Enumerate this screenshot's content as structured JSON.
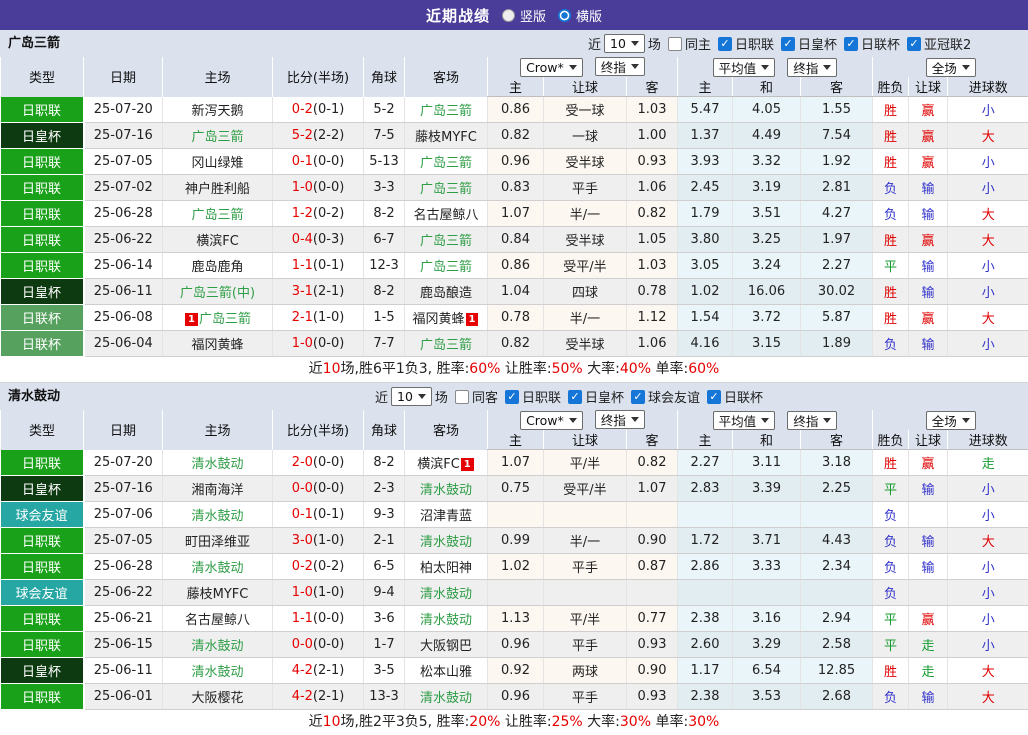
{
  "topbar": {
    "title": "近期战绩",
    "radios": [
      {
        "label": "竖版",
        "checked": false
      },
      {
        "label": "横版",
        "checked": true
      }
    ],
    "bar_color": "#4A3C99"
  },
  "colors": {
    "type_league": {
      "日职联": "#1AA11A",
      "日皇杯": "#0D3A10",
      "日联杯": "#57A15F",
      "球会友谊": "#27A7A4"
    },
    "result": {
      "red": "#E00000",
      "blue": "#3333CC",
      "green": "#149B2E"
    },
    "team_highlight": "#2E9E46",
    "score": "#E60000",
    "checkbox": "#1576D8"
  },
  "table_header": {
    "left_cols": [
      "类型",
      "日期",
      "主场",
      "比分(半场)",
      "角球",
      "客场"
    ],
    "group1_dropdowns": [
      "Crow*",
      "终指"
    ],
    "group2_dropdowns": [
      "平均值",
      "终指"
    ],
    "group3_dropdown": "全场",
    "sub_cols": [
      "主",
      "让球",
      "客",
      "主",
      "和",
      "客",
      "胜负",
      "让球",
      "进球数"
    ]
  },
  "sections": [
    {
      "team": "广岛三箭",
      "filter": {
        "prefix": "近",
        "count": "10",
        "suffix": "场",
        "same": {
          "label": "同主",
          "checked": false
        },
        "leagues": [
          {
            "label": "日职联",
            "checked": true
          },
          {
            "label": "日皇杯",
            "checked": true
          },
          {
            "label": "日联杯",
            "checked": true
          },
          {
            "label": "亚冠联2",
            "checked": true
          }
        ]
      },
      "rows": [
        {
          "type": "日职联",
          "date": "25-07-20",
          "home": "新泻天鹅",
          "home_hl": false,
          "home_badge": "",
          "score_ft": "0-2",
          "score_ht": "(0-1)",
          "corner": "5-2",
          "away": "广岛三箭",
          "away_hl": true,
          "away_badge": "",
          "odds_home": "0.86",
          "odds_hcap": "受一球",
          "odds_away": "1.03",
          "avg_home": "5.47",
          "avg_draw": "4.05",
          "avg_away": "1.55",
          "res_wdl": "胜",
          "res_wdl_color": "red",
          "res_hcap": "赢",
          "res_hcap_color": "red",
          "res_goals": "小",
          "res_goals_color": "blue"
        },
        {
          "type": "日皇杯",
          "date": "25-07-16",
          "home": "广岛三箭",
          "home_hl": true,
          "home_badge": "",
          "score_ft": "5-2",
          "score_ht": "(2-2)",
          "corner": "7-5",
          "away": "藤枝MYFC",
          "away_hl": false,
          "away_badge": "",
          "odds_home": "0.82",
          "odds_hcap": "一球",
          "odds_away": "1.00",
          "avg_home": "1.37",
          "avg_draw": "4.49",
          "avg_away": "7.54",
          "res_wdl": "胜",
          "res_wdl_color": "red",
          "res_hcap": "赢",
          "res_hcap_color": "red",
          "res_goals": "大",
          "res_goals_color": "red"
        },
        {
          "type": "日职联",
          "date": "25-07-05",
          "home": "冈山绿雉",
          "home_hl": false,
          "home_badge": "",
          "score_ft": "0-1",
          "score_ht": "(0-0)",
          "corner": "5-13",
          "away": "广岛三箭",
          "away_hl": true,
          "away_badge": "",
          "odds_home": "0.96",
          "odds_hcap": "受半球",
          "odds_away": "0.93",
          "avg_home": "3.93",
          "avg_draw": "3.32",
          "avg_away": "1.92",
          "res_wdl": "胜",
          "res_wdl_color": "red",
          "res_hcap": "赢",
          "res_hcap_color": "red",
          "res_goals": "小",
          "res_goals_color": "blue"
        },
        {
          "type": "日职联",
          "date": "25-07-02",
          "home": "神户胜利船",
          "home_hl": false,
          "home_badge": "",
          "score_ft": "1-0",
          "score_ht": "(0-0)",
          "corner": "3-3",
          "away": "广岛三箭",
          "away_hl": true,
          "away_badge": "",
          "odds_home": "0.83",
          "odds_hcap": "平手",
          "odds_away": "1.06",
          "avg_home": "2.45",
          "avg_draw": "3.19",
          "avg_away": "2.81",
          "res_wdl": "负",
          "res_wdl_color": "blue",
          "res_hcap": "输",
          "res_hcap_color": "blue",
          "res_goals": "小",
          "res_goals_color": "blue"
        },
        {
          "type": "日职联",
          "date": "25-06-28",
          "home": "广岛三箭",
          "home_hl": true,
          "home_badge": "",
          "score_ft": "1-2",
          "score_ht": "(0-2)",
          "corner": "8-2",
          "away": "名古屋鲸八",
          "away_hl": false,
          "away_badge": "",
          "odds_home": "1.07",
          "odds_hcap": "半/一",
          "odds_away": "0.82",
          "avg_home": "1.79",
          "avg_draw": "3.51",
          "avg_away": "4.27",
          "res_wdl": "负",
          "res_wdl_color": "blue",
          "res_hcap": "输",
          "res_hcap_color": "blue",
          "res_goals": "大",
          "res_goals_color": "red"
        },
        {
          "type": "日职联",
          "date": "25-06-22",
          "home": "横滨FC",
          "home_hl": false,
          "home_badge": "",
          "score_ft": "0-4",
          "score_ht": "(0-3)",
          "corner": "6-7",
          "away": "广岛三箭",
          "away_hl": true,
          "away_badge": "",
          "odds_home": "0.84",
          "odds_hcap": "受半球",
          "odds_away": "1.05",
          "avg_home": "3.80",
          "avg_draw": "3.25",
          "avg_away": "1.97",
          "res_wdl": "胜",
          "res_wdl_color": "red",
          "res_hcap": "赢",
          "res_hcap_color": "red",
          "res_goals": "大",
          "res_goals_color": "red"
        },
        {
          "type": "日职联",
          "date": "25-06-14",
          "home": "鹿岛鹿角",
          "home_hl": false,
          "home_badge": "",
          "score_ft": "1-1",
          "score_ht": "(0-1)",
          "corner": "12-3",
          "away": "广岛三箭",
          "away_hl": true,
          "away_badge": "",
          "odds_home": "0.86",
          "odds_hcap": "受平/半",
          "odds_away": "1.03",
          "avg_home": "3.05",
          "avg_draw": "3.24",
          "avg_away": "2.27",
          "res_wdl": "平",
          "res_wdl_color": "green",
          "res_hcap": "输",
          "res_hcap_color": "blue",
          "res_goals": "小",
          "res_goals_color": "blue"
        },
        {
          "type": "日皇杯",
          "date": "25-06-11",
          "home": "广岛三箭(中)",
          "home_hl": true,
          "home_badge": "",
          "score_ft": "3-1",
          "score_ht": "(2-1)",
          "corner": "8-2",
          "away": "鹿岛酿造",
          "away_hl": false,
          "away_badge": "",
          "odds_home": "1.04",
          "odds_hcap": "四球",
          "odds_away": "0.78",
          "avg_home": "1.02",
          "avg_draw": "16.06",
          "avg_away": "30.02",
          "res_wdl": "胜",
          "res_wdl_color": "red",
          "res_hcap": "输",
          "res_hcap_color": "blue",
          "res_goals": "小",
          "res_goals_color": "blue"
        },
        {
          "type": "日联杯",
          "date": "25-06-08",
          "home": "广岛三箭",
          "home_hl": true,
          "home_badge": "1",
          "score_ft": "2-1",
          "score_ht": "(1-0)",
          "corner": "1-5",
          "away": "福冈黄蜂",
          "away_hl": false,
          "away_badge": "1",
          "odds_home": "0.78",
          "odds_hcap": "半/一",
          "odds_away": "1.12",
          "avg_home": "1.54",
          "avg_draw": "3.72",
          "avg_away": "5.87",
          "res_wdl": "胜",
          "res_wdl_color": "red",
          "res_hcap": "赢",
          "res_hcap_color": "red",
          "res_goals": "大",
          "res_goals_color": "red"
        },
        {
          "type": "日联杯",
          "date": "25-06-04",
          "home": "福冈黄蜂",
          "home_hl": false,
          "home_badge": "",
          "score_ft": "1-0",
          "score_ht": "(0-0)",
          "corner": "7-7",
          "away": "广岛三箭",
          "away_hl": true,
          "away_badge": "",
          "odds_home": "0.82",
          "odds_hcap": "受半球",
          "odds_away": "1.06",
          "avg_home": "4.16",
          "avg_draw": "3.15",
          "avg_away": "1.89",
          "res_wdl": "负",
          "res_wdl_color": "blue",
          "res_hcap": "输",
          "res_hcap_color": "blue",
          "res_goals": "小",
          "res_goals_color": "blue"
        }
      ],
      "summary": [
        {
          "text": "近",
          "red": false
        },
        {
          "text": "10",
          "red": true
        },
        {
          "text": "场,胜6平1负3, 胜率:",
          "red": false
        },
        {
          "text": "60%",
          "red": true
        },
        {
          "text": " 让胜率:",
          "red": false
        },
        {
          "text": "50%",
          "red": true
        },
        {
          "text": " 大率:",
          "red": false
        },
        {
          "text": "40%",
          "red": true
        },
        {
          "text": " 单率:",
          "red": false
        },
        {
          "text": "60%",
          "red": true
        }
      ]
    },
    {
      "team": "清水鼓动",
      "filter": {
        "prefix": "近",
        "count": "10",
        "suffix": "场",
        "same": {
          "label": "同客",
          "checked": false
        },
        "leagues": [
          {
            "label": "日职联",
            "checked": true
          },
          {
            "label": "日皇杯",
            "checked": true
          },
          {
            "label": "球会友谊",
            "checked": true
          },
          {
            "label": "日联杯",
            "checked": true
          }
        ]
      },
      "rows": [
        {
          "type": "日职联",
          "date": "25-07-20",
          "home": "清水鼓动",
          "home_hl": true,
          "home_badge": "",
          "score_ft": "2-0",
          "score_ht": "(0-0)",
          "corner": "8-2",
          "away": "横滨FC",
          "away_hl": false,
          "away_badge": "1",
          "odds_home": "1.07",
          "odds_hcap": "平/半",
          "odds_away": "0.82",
          "avg_home": "2.27",
          "avg_draw": "3.11",
          "avg_away": "3.18",
          "res_wdl": "胜",
          "res_wdl_color": "red",
          "res_hcap": "赢",
          "res_hcap_color": "red",
          "res_goals": "走",
          "res_goals_color": "green"
        },
        {
          "type": "日皇杯",
          "date": "25-07-16",
          "home": "湘南海洋",
          "home_hl": false,
          "home_badge": "",
          "score_ft": "0-0",
          "score_ht": "(0-0)",
          "corner": "2-3",
          "away": "清水鼓动",
          "away_hl": true,
          "away_badge": "",
          "odds_home": "0.75",
          "odds_hcap": "受平/半",
          "odds_away": "1.07",
          "avg_home": "2.83",
          "avg_draw": "3.39",
          "avg_away": "2.25",
          "res_wdl": "平",
          "res_wdl_color": "green",
          "res_hcap": "输",
          "res_hcap_color": "blue",
          "res_goals": "小",
          "res_goals_color": "blue"
        },
        {
          "type": "球会友谊",
          "date": "25-07-06",
          "home": "清水鼓动",
          "home_hl": true,
          "home_badge": "",
          "score_ft": "0-1",
          "score_ht": "(0-1)",
          "corner": "9-3",
          "away": "沼津青蓝",
          "away_hl": false,
          "away_badge": "",
          "odds_home": "",
          "odds_hcap": "",
          "odds_away": "",
          "avg_home": "",
          "avg_draw": "",
          "avg_away": "",
          "res_wdl": "负",
          "res_wdl_color": "blue",
          "res_hcap": "",
          "res_hcap_color": "",
          "res_goals": "小",
          "res_goals_color": "blue"
        },
        {
          "type": "日职联",
          "date": "25-07-05",
          "home": "町田泽维亚",
          "home_hl": false,
          "home_badge": "",
          "score_ft": "3-0",
          "score_ht": "(1-0)",
          "corner": "2-1",
          "away": "清水鼓动",
          "away_hl": true,
          "away_badge": "",
          "odds_home": "0.99",
          "odds_hcap": "半/一",
          "odds_away": "0.90",
          "avg_home": "1.72",
          "avg_draw": "3.71",
          "avg_away": "4.43",
          "res_wdl": "负",
          "res_wdl_color": "blue",
          "res_hcap": "输",
          "res_hcap_color": "blue",
          "res_goals": "大",
          "res_goals_color": "red"
        },
        {
          "type": "日职联",
          "date": "25-06-28",
          "home": "清水鼓动",
          "home_hl": true,
          "home_badge": "",
          "score_ft": "0-2",
          "score_ht": "(0-2)",
          "corner": "6-5",
          "away": "柏太阳神",
          "away_hl": false,
          "away_badge": "",
          "odds_home": "1.02",
          "odds_hcap": "平手",
          "odds_away": "0.87",
          "avg_home": "2.86",
          "avg_draw": "3.33",
          "avg_away": "2.34",
          "res_wdl": "负",
          "res_wdl_color": "blue",
          "res_hcap": "输",
          "res_hcap_color": "blue",
          "res_goals": "小",
          "res_goals_color": "blue"
        },
        {
          "type": "球会友谊",
          "date": "25-06-22",
          "home": "藤枝MYFC",
          "home_hl": false,
          "home_badge": "",
          "score_ft": "1-0",
          "score_ht": "(1-0)",
          "corner": "9-4",
          "away": "清水鼓动",
          "away_hl": true,
          "away_badge": "",
          "odds_home": "",
          "odds_hcap": "",
          "odds_away": "",
          "avg_home": "",
          "avg_draw": "",
          "avg_away": "",
          "res_wdl": "负",
          "res_wdl_color": "blue",
          "res_hcap": "",
          "res_hcap_color": "",
          "res_goals": "小",
          "res_goals_color": "blue"
        },
        {
          "type": "日职联",
          "date": "25-06-21",
          "home": "名古屋鲸八",
          "home_hl": false,
          "home_badge": "",
          "score_ft": "1-1",
          "score_ht": "(0-0)",
          "corner": "3-6",
          "away": "清水鼓动",
          "away_hl": true,
          "away_badge": "",
          "odds_home": "1.13",
          "odds_hcap": "平/半",
          "odds_away": "0.77",
          "avg_home": "2.38",
          "avg_draw": "3.16",
          "avg_away": "2.94",
          "res_wdl": "平",
          "res_wdl_color": "green",
          "res_hcap": "赢",
          "res_hcap_color": "red",
          "res_goals": "小",
          "res_goals_color": "blue"
        },
        {
          "type": "日职联",
          "date": "25-06-15",
          "home": "清水鼓动",
          "home_hl": true,
          "home_badge": "",
          "score_ft": "0-0",
          "score_ht": "(0-0)",
          "corner": "1-7",
          "away": "大阪钢巴",
          "away_hl": false,
          "away_badge": "",
          "odds_home": "0.96",
          "odds_hcap": "平手",
          "odds_away": "0.93",
          "avg_home": "2.60",
          "avg_draw": "3.29",
          "avg_away": "2.58",
          "res_wdl": "平",
          "res_wdl_color": "green",
          "res_hcap": "走",
          "res_hcap_color": "green",
          "res_goals": "小",
          "res_goals_color": "blue"
        },
        {
          "type": "日皇杯",
          "date": "25-06-11",
          "home": "清水鼓动",
          "home_hl": true,
          "home_badge": "",
          "score_ft": "4-2",
          "score_ht": "(2-1)",
          "corner": "3-5",
          "away": "松本山雅",
          "away_hl": false,
          "away_badge": "",
          "odds_home": "0.92",
          "odds_hcap": "两球",
          "odds_away": "0.90",
          "avg_home": "1.17",
          "avg_draw": "6.54",
          "avg_away": "12.85",
          "res_wdl": "胜",
          "res_wdl_color": "red",
          "res_hcap": "走",
          "res_hcap_color": "green",
          "res_goals": "大",
          "res_goals_color": "red"
        },
        {
          "type": "日职联",
          "date": "25-06-01",
          "home": "大阪樱花",
          "home_hl": false,
          "home_badge": "",
          "score_ft": "4-2",
          "score_ht": "(2-1)",
          "corner": "13-3",
          "away": "清水鼓动",
          "away_hl": true,
          "away_badge": "",
          "odds_home": "0.96",
          "odds_hcap": "平手",
          "odds_away": "0.93",
          "avg_home": "2.38",
          "avg_draw": "3.53",
          "avg_away": "2.68",
          "res_wdl": "负",
          "res_wdl_color": "blue",
          "res_hcap": "输",
          "res_hcap_color": "blue",
          "res_goals": "大",
          "res_goals_color": "red"
        }
      ],
      "summary": [
        {
          "text": "近",
          "red": false
        },
        {
          "text": "10",
          "red": true
        },
        {
          "text": "场,胜2平3负5, 胜率:",
          "red": false
        },
        {
          "text": "20%",
          "red": true
        },
        {
          "text": " 让胜率:",
          "red": false
        },
        {
          "text": "25%",
          "red": true
        },
        {
          "text": " 大率:",
          "red": false
        },
        {
          "text": "30%",
          "red": true
        },
        {
          "text": " 单率:",
          "red": false
        },
        {
          "text": "30%",
          "red": true
        }
      ]
    }
  ]
}
